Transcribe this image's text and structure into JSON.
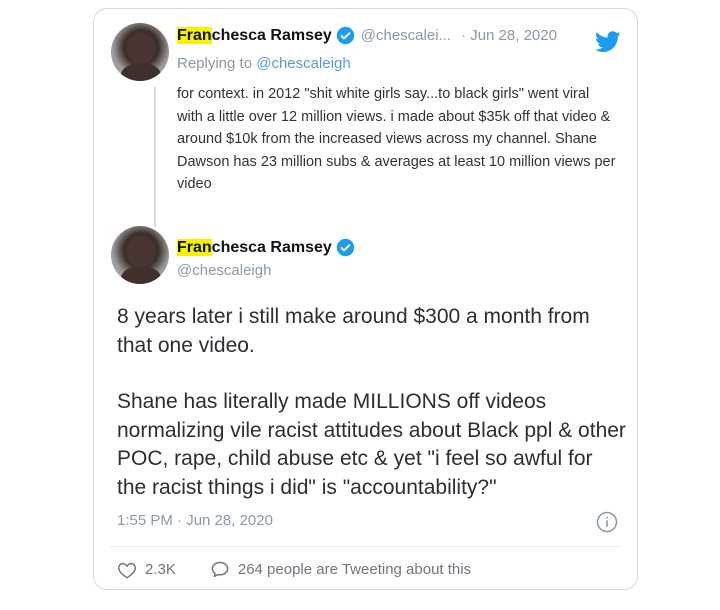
{
  "reply_tweet": {
    "author": {
      "name_highlight": "Fran",
      "name_rest": "chesca Ramsey",
      "handle": "@chescalei...",
      "date": "· Jun 28, 2020"
    },
    "replying_prefix": "Replying to",
    "replying_handle": "@chescaleigh",
    "text": "for context. in 2012 \"shit white girls say...to black girls\" went viral with a little over 12 million views. i made about $35k off that video & around $10k from the increased views across my channel. Shane Dawson has 23 million subs & averages at least 10 million views per video"
  },
  "main_tweet": {
    "author": {
      "name_highlight": "Fran",
      "name_rest": "chesca Ramsey",
      "handle": "@chescaleigh"
    },
    "paragraphs": [
      "8 years later i still make around $300 a month from that one video.",
      "Shane has literally made MILLIONS off videos normalizing vile racist attitudes about Black ppl & other POC, rape, child abuse etc & yet \"i feel so awful for the racist things i did\" is \"accountability?\""
    ],
    "timestamp": "1:55 PM · Jun 28, 2020",
    "likes": "2.3K",
    "conversation": "264 people are Tweeting about this"
  },
  "icons": {
    "verified": "verified-badge-icon",
    "brand": "twitter-bird-icon",
    "info": "info-icon",
    "like": "heart-icon",
    "reply": "speech-bubble-icon"
  },
  "colors": {
    "verified_blue": "#1d9bf0",
    "twitter_blue": "#1d9bf0",
    "name_highlight": "#f6f300",
    "secondary_text": "#8b98a5"
  }
}
